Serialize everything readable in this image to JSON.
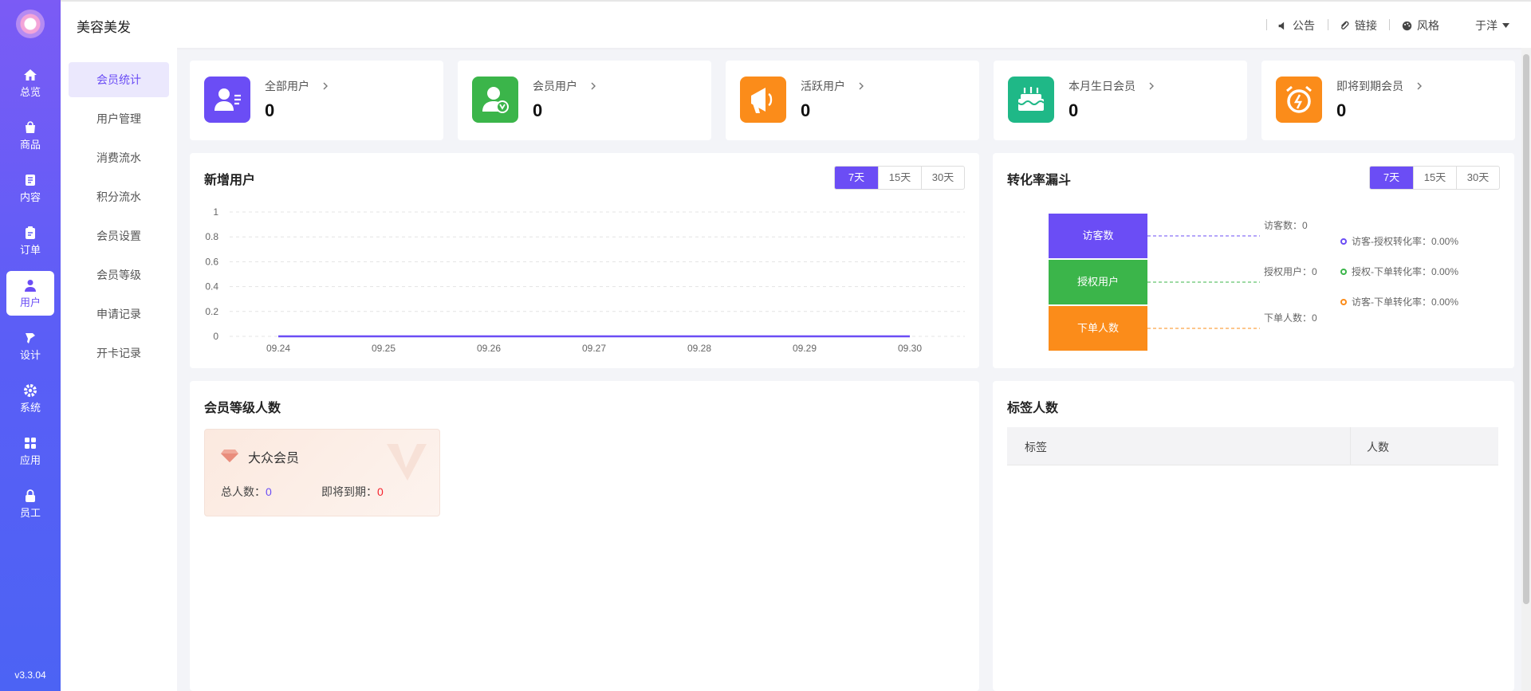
{
  "app": {
    "brand": "美容美发",
    "version": "v3.3.04"
  },
  "header": {
    "notice": "公告",
    "link": "链接",
    "style": "风格",
    "user": "于洋"
  },
  "nav": [
    {
      "label": "总览",
      "icon": "home-icon"
    },
    {
      "label": "商品",
      "icon": "bag-icon"
    },
    {
      "label": "内容",
      "icon": "document-icon"
    },
    {
      "label": "订单",
      "icon": "clipboard-icon"
    },
    {
      "label": "用户",
      "icon": "user-icon",
      "active": true
    },
    {
      "label": "设计",
      "icon": "brush-icon"
    },
    {
      "label": "系统",
      "icon": "gear-icon"
    },
    {
      "label": "应用",
      "icon": "apps-icon"
    },
    {
      "label": "员工",
      "icon": "lock-icon"
    }
  ],
  "subnav": [
    {
      "label": "会员统计",
      "active": true
    },
    {
      "label": "用户管理"
    },
    {
      "label": "消费流水"
    },
    {
      "label": "积分流水"
    },
    {
      "label": "会员设置"
    },
    {
      "label": "会员等级"
    },
    {
      "label": "申请记录"
    },
    {
      "label": "开卡记录"
    }
  ],
  "stats": [
    {
      "title": "全部用户",
      "value": "0",
      "color": "#6b4df5",
      "icon": "user-card-icon"
    },
    {
      "title": "会员用户",
      "value": "0",
      "color": "#3bb54a",
      "icon": "member-icon"
    },
    {
      "title": "活跃用户",
      "value": "0",
      "color": "#fb8c1a",
      "icon": "megaphone-icon"
    },
    {
      "title": "本月生日会员",
      "value": "0",
      "color": "#1fb887",
      "icon": "cake-icon"
    },
    {
      "title": "即将到期会员",
      "value": "0",
      "color": "#fb8c1a",
      "icon": "alarm-icon"
    }
  ],
  "new_users": {
    "title": "新增用户",
    "ranges": [
      "7天",
      "15天",
      "30天"
    ],
    "active_range": "7天"
  },
  "chart_data": {
    "type": "line",
    "title": "新增用户",
    "categories": [
      "09.24",
      "09.25",
      "09.26",
      "09.27",
      "09.28",
      "09.29",
      "09.30"
    ],
    "series": [
      {
        "values": [
          0,
          0,
          0,
          0,
          0,
          0,
          0
        ]
      }
    ],
    "ylim": [
      0,
      1
    ],
    "yticks": [
      "0",
      "0.2",
      "0.4",
      "0.6",
      "0.8",
      "1"
    ],
    "grid": true,
    "line_color": "#6b4df5"
  },
  "funnel": {
    "title": "转化率漏斗",
    "ranges": [
      "7天",
      "15天",
      "30天"
    ],
    "active_range": "7天",
    "stages": [
      {
        "label": "访客数",
        "note": "访客数：0",
        "color": "#6b4df5"
      },
      {
        "label": "授权用户",
        "note": "授权用户：0",
        "color": "#3bb54a"
      },
      {
        "label": "下单人数",
        "note": "下单人数：0",
        "color": "#fb8c1a"
      }
    ],
    "legend": [
      {
        "text": "访客-授权转化率：0.00%",
        "color": "#6b4df5"
      },
      {
        "text": "授权-下单转化率：0.00%",
        "color": "#3bb54a"
      },
      {
        "text": "访客-下单转化率：0.00%",
        "color": "#fb8c1a"
      }
    ]
  },
  "levels": {
    "title": "会员等级人数",
    "card": {
      "name": "大众会员",
      "total_label": "总人数：",
      "total_value": "0",
      "expire_label": "即将到期：",
      "expire_value": "0"
    }
  },
  "tags": {
    "title": "标签人数",
    "columns": [
      "标签",
      "人数"
    ]
  }
}
